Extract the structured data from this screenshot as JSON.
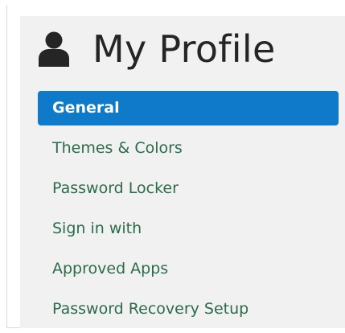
{
  "header": {
    "title": "My Profile",
    "icon": "user-icon"
  },
  "nav": {
    "items": [
      {
        "label": "General",
        "active": true
      },
      {
        "label": "Themes & Colors",
        "active": false
      },
      {
        "label": "Password Locker",
        "active": false
      },
      {
        "label": "Sign in with",
        "active": false
      },
      {
        "label": "Approved Apps",
        "active": false
      },
      {
        "label": "Password Recovery Setup",
        "active": false
      }
    ]
  },
  "colors": {
    "accent": "#0e7ac9",
    "link": "#2c6b4b",
    "panel_bg": "#f1f1f1",
    "title": "#252525"
  }
}
